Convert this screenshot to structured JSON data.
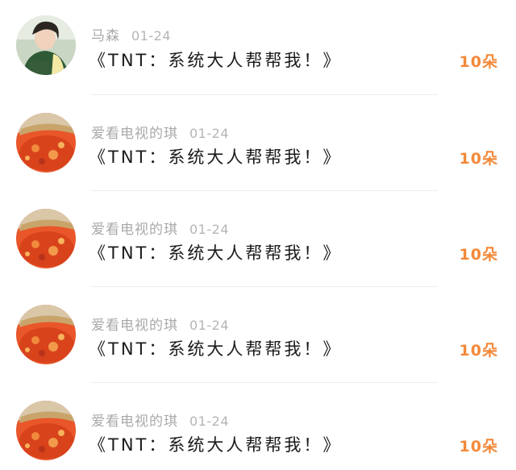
{
  "colors": {
    "count_accent": "#f2893a",
    "meta_text": "#a9a9a9",
    "title_text": "#1b1b1b",
    "divider": "#ededed"
  },
  "items": [
    {
      "avatar": "person-photo",
      "username": "马森",
      "date": "01-24",
      "title": "《TNT：系统大人帮帮我！》",
      "count": "10朵"
    },
    {
      "avatar": "food-hotpot-photo",
      "username": "爱看电视的琪",
      "date": "01-24",
      "title": "《TNT：系统大人帮帮我！》",
      "count": "10朵"
    },
    {
      "avatar": "food-hotpot-photo",
      "username": "爱看电视的琪",
      "date": "01-24",
      "title": "《TNT：系统大人帮帮我！》",
      "count": "10朵"
    },
    {
      "avatar": "food-hotpot-photo",
      "username": "爱看电视的琪",
      "date": "01-24",
      "title": "《TNT：系统大人帮帮我！》",
      "count": "10朵"
    },
    {
      "avatar": "food-hotpot-photo",
      "username": "爱看电视的琪",
      "date": "01-24",
      "title": "《TNT：系统大人帮帮我！》",
      "count": "10朵"
    }
  ]
}
